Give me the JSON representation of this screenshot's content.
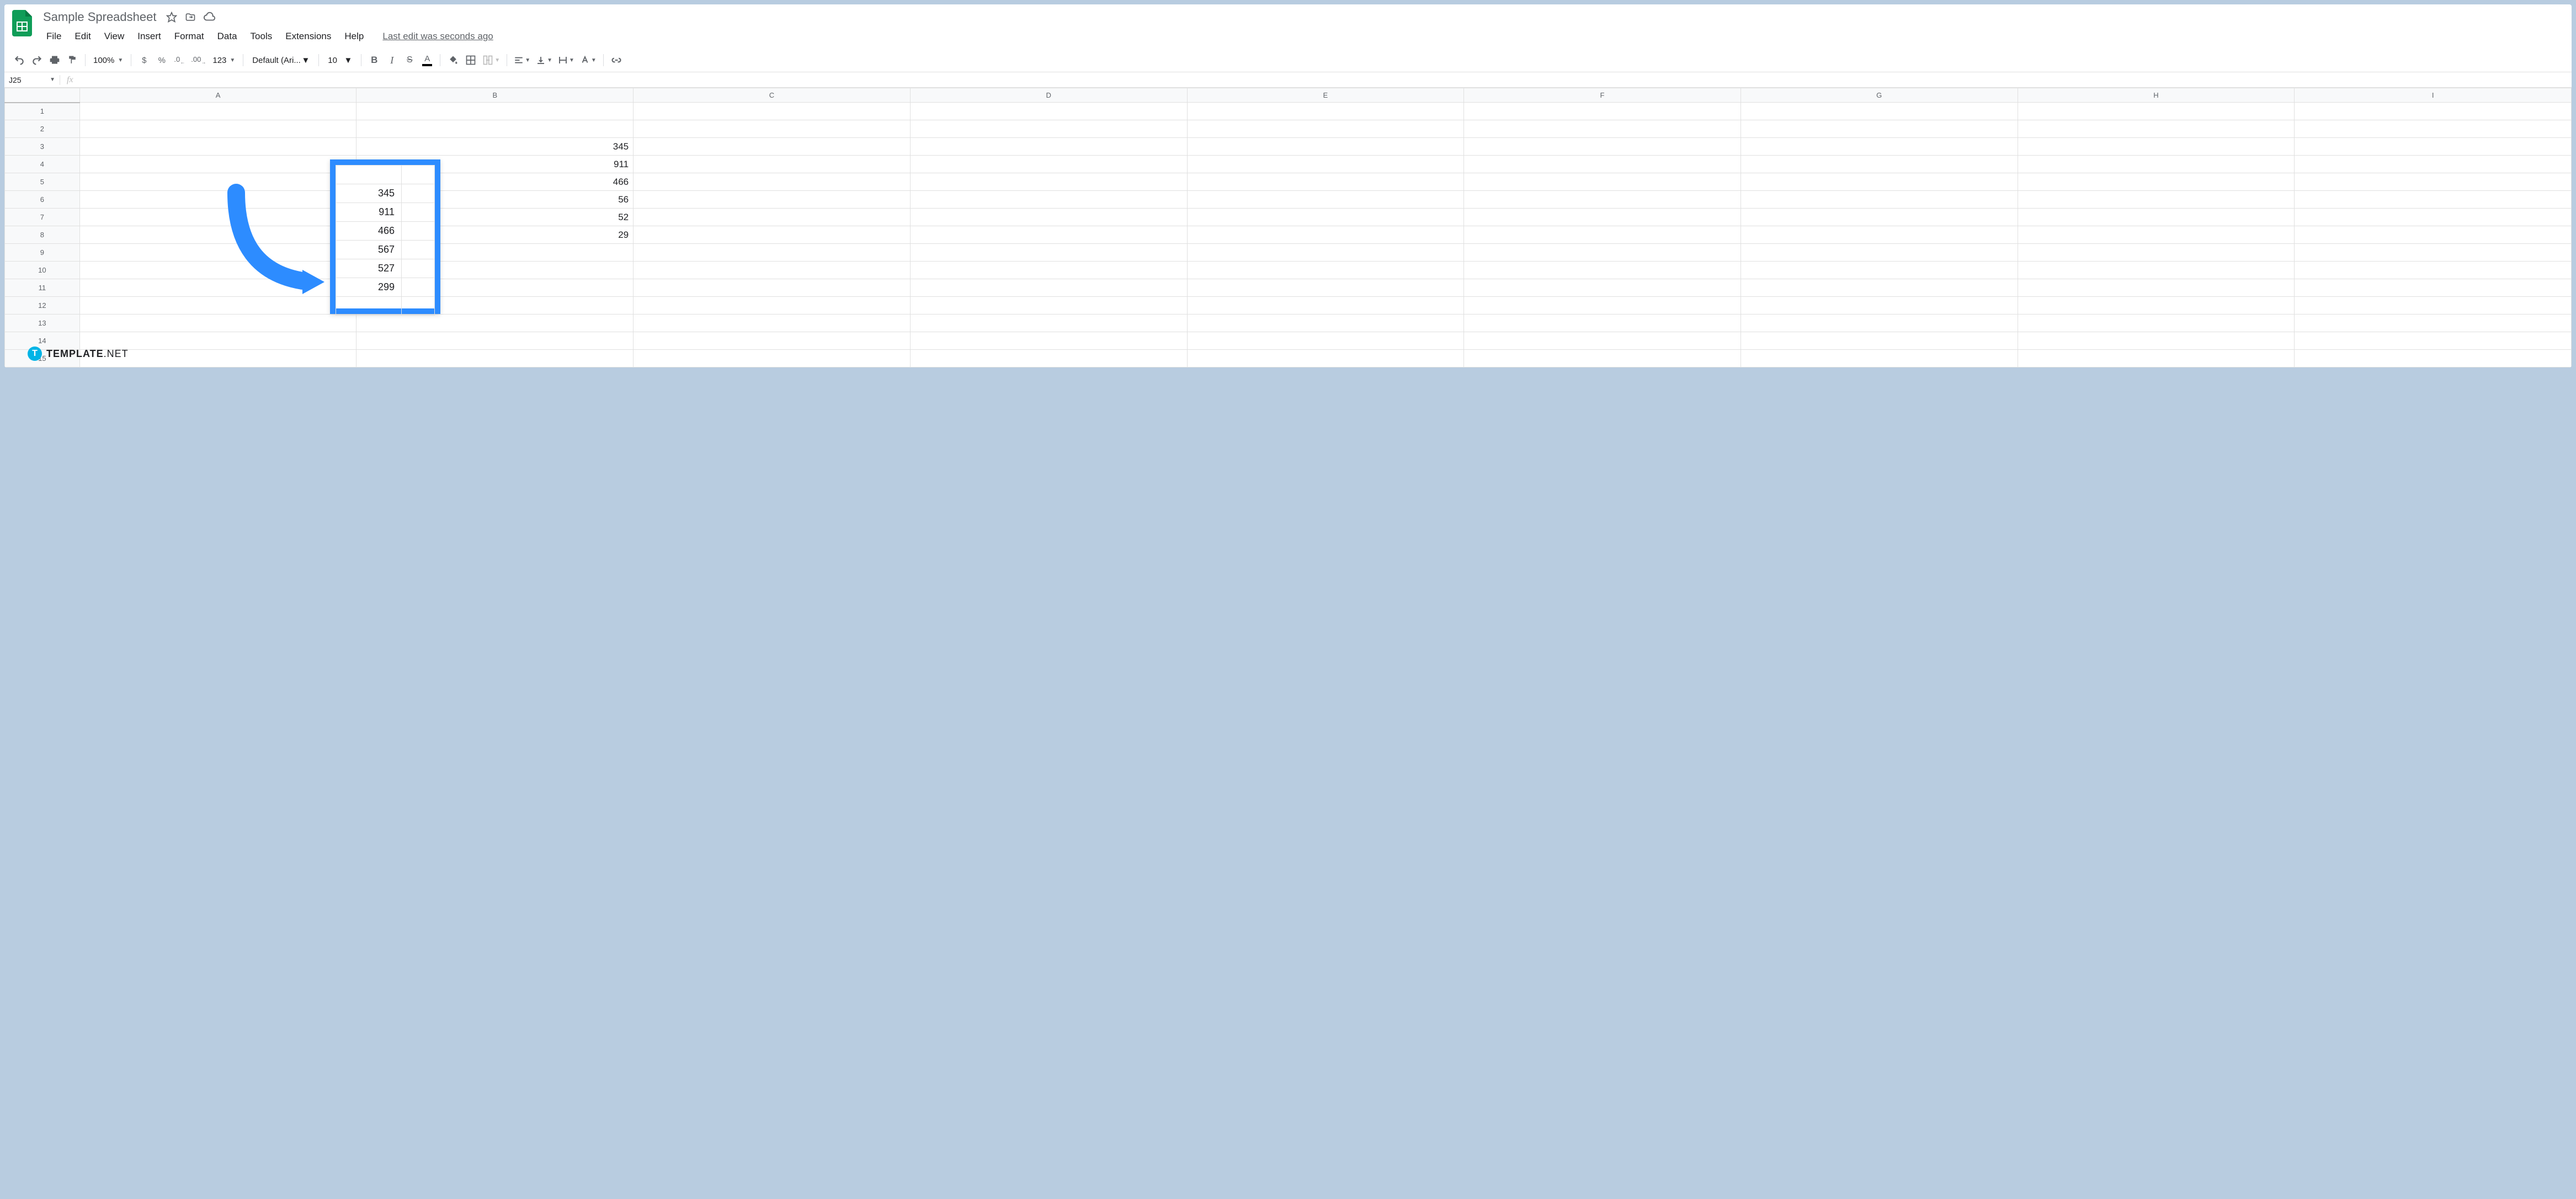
{
  "header": {
    "title": "Sample Spreadsheet",
    "last_edit": "Last edit was seconds ago"
  },
  "menubar": {
    "items": [
      "File",
      "Edit",
      "View",
      "Insert",
      "Format",
      "Data",
      "Tools",
      "Extensions",
      "Help"
    ]
  },
  "toolbar": {
    "zoom": "100%",
    "currency": "$",
    "percent": "%",
    "dec_decrease": ".0",
    "dec_increase": ".00",
    "num_format": "123",
    "font": "Default (Ari...",
    "font_size": "10",
    "bold": "B",
    "italic": "I",
    "strike": "S",
    "text_a": "A"
  },
  "namebox": {
    "cell_ref": "J25",
    "fx": "fx"
  },
  "grid": {
    "columns": [
      "A",
      "B",
      "C",
      "D",
      "E",
      "F",
      "G",
      "H",
      "I"
    ],
    "rows": [
      "1",
      "2",
      "3",
      "4",
      "5",
      "6",
      "7",
      "8",
      "9",
      "10",
      "11",
      "12",
      "13",
      "14",
      "15"
    ],
    "cells": {
      "B3": "345",
      "B4": "911",
      "B5": "466",
      "B6": "56",
      "B7": "52",
      "B8": "29"
    }
  },
  "callout": {
    "values": [
      "345",
      "911",
      "466",
      "567",
      "527",
      "299"
    ]
  },
  "watermark": {
    "logo": "T",
    "text": "TEMPLATE",
    "suffix": ".NET"
  }
}
